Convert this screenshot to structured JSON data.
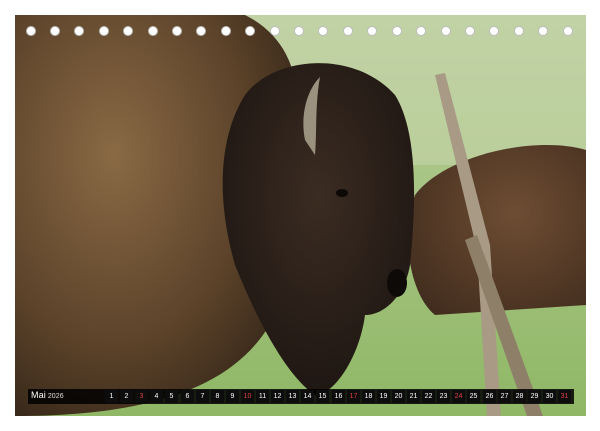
{
  "calendar": {
    "month": "Mai",
    "year": "2026",
    "days": [
      "1",
      "2",
      "3",
      "4",
      "5",
      "6",
      "7",
      "8",
      "9",
      "10",
      "11",
      "12",
      "13",
      "14",
      "15",
      "16",
      "17",
      "18",
      "19",
      "20",
      "21",
      "22",
      "23",
      "24",
      "25",
      "26",
      "27",
      "28",
      "29",
      "30",
      "31"
    ],
    "sundays": [
      "3",
      "10",
      "17",
      "24",
      "31"
    ],
    "accent_color": "#e04040"
  },
  "photo": {
    "subject": "bison-head-icon"
  }
}
